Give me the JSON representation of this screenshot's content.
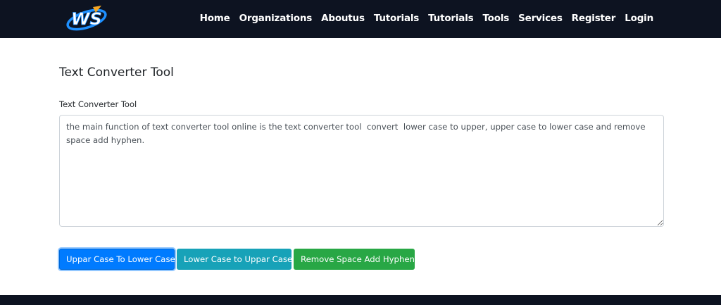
{
  "header": {
    "logo_text": "WS",
    "nav": [
      "Home",
      "Organizations",
      "Aboutus",
      "Tutorials",
      "Tutorials",
      "Tools",
      "Services",
      "Register",
      "Login"
    ]
  },
  "main": {
    "title": "Text Converter Tool",
    "field_label": "Text Converter Tool",
    "textarea_value": "the main function of text converter tool online is the text converter tool  convert  lower case to upper, upper case to lower case and remove space add hyphen.",
    "buttons": {
      "upper_to_lower": "Uppar Case To Lower Case",
      "lower_to_upper": "Lower Case to Uppar Case",
      "remove_space": "Remove Space Add Hyphen"
    }
  },
  "colors": {
    "nav_bg": "#0d1321",
    "primary": "#007bff",
    "info": "#17a2b8",
    "success": "#28a745",
    "logo_blue": "#1e90ff",
    "logo_gold": "#f5a623"
  }
}
